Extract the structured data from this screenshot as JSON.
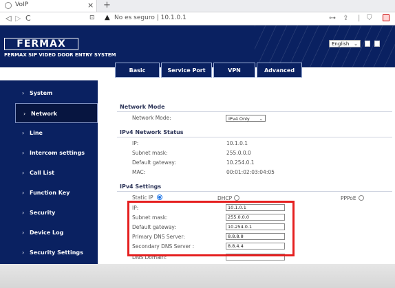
{
  "browser": {
    "tab_title": "VoIP",
    "tab_close": "×",
    "new_tab": "+",
    "nav_back": "◁",
    "nav_forward": "▷",
    "reload": "C",
    "security_label": "No es seguro",
    "url": "10.1.0.1"
  },
  "header": {
    "logo": "FERMAX",
    "tagline": "FERMAX SIP VIDEO DOOR ENTRY SYSTEM",
    "language": "English"
  },
  "tabs": [
    "Basic",
    "Service Port",
    "VPN",
    "Advanced"
  ],
  "sidebar": [
    "System",
    "Network",
    "Line",
    "Intercom settings",
    "Call List",
    "Function Key",
    "Security",
    "Device Log",
    "Security Settings"
  ],
  "network_mode": {
    "title": "Network Mode",
    "label": "Network Mode:",
    "value": "IPv4 Only"
  },
  "ipv4_status": {
    "title": "IPv4 Network Status",
    "rows": [
      {
        "label": "IP:",
        "value": "10.1.0.1"
      },
      {
        "label": "Subnet mask:",
        "value": "255.0.0.0"
      },
      {
        "label": "Default gateway:",
        "value": "10.254.0.1"
      },
      {
        "label": "MAC:",
        "value": "00:01:02:03:04:05"
      }
    ]
  },
  "ipv4_settings": {
    "title": "IPv4 Settings",
    "modes": [
      "Static IP",
      "DHCP",
      "PPPoE"
    ],
    "selected_mode": "Static IP",
    "fields": [
      {
        "label": "IP:",
        "value": "10.1.0.1"
      },
      {
        "label": "Subnet mask:",
        "value": "255.0.0.0"
      },
      {
        "label": "Default gateway:",
        "value": "10.254.0.1"
      },
      {
        "label": "Primary DNS Server:",
        "value": "8.8.8.8"
      },
      {
        "label": "Secondary DNS Server :",
        "value": "8.8.4.4"
      },
      {
        "label": "DNS Domain:",
        "value": ""
      }
    ]
  },
  "colors": {
    "header_bg": "#0a2161",
    "active_item_bg": "#071540",
    "highlight": "#e51f1f",
    "radio_selected": "#1a73e8"
  }
}
